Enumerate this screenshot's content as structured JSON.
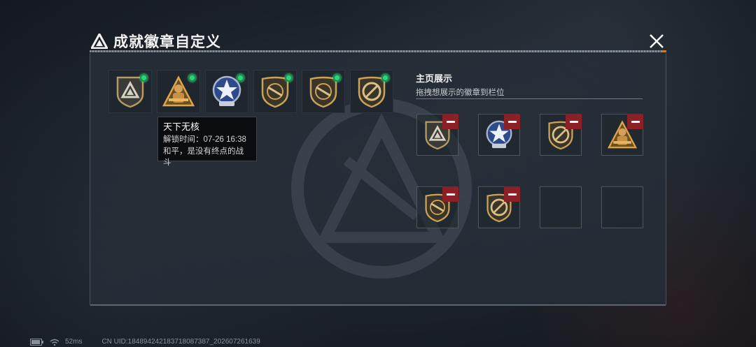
{
  "header": {
    "title": "成就徽章自定义",
    "title_icon": "triangle-emblem-icon",
    "close_icon": "close-icon"
  },
  "owned_badges": [
    {
      "name": "triangle-shield-badge",
      "unlocked": true
    },
    {
      "name": "soldier-triangle-badge",
      "unlocked": true
    },
    {
      "name": "star-round-badge",
      "unlocked": true
    },
    {
      "name": "rifle-shield-badge",
      "unlocked": true
    },
    {
      "name": "rifle-shield-badge",
      "unlocked": true
    },
    {
      "name": "no-gun-shield-badge",
      "unlocked": true
    }
  ],
  "tooltip": {
    "name": "天下无核",
    "unlock_label": "解锁时间：",
    "unlock_time": "07-26 16:38",
    "description": "和平，是没有终点的战斗"
  },
  "display": {
    "title": "主页展示",
    "subtitle": "拖拽想展示的徽章到栏位",
    "slots": [
      {
        "badge": "triangle-shield-badge",
        "removable": true
      },
      {
        "badge": "star-round-badge",
        "removable": true
      },
      {
        "badge": "no-gun-shield-badge",
        "removable": true
      },
      {
        "badge": "soldier-triangle-badge",
        "removable": true
      },
      {
        "badge": "rifle-shield-badge",
        "removable": true
      },
      {
        "badge": "no-gun-shield-badge",
        "removable": true
      },
      {
        "badge": "",
        "removable": false
      },
      {
        "badge": "",
        "removable": false
      }
    ]
  },
  "status_bar": {
    "ping": "52ms",
    "uid": "CN UID:1848942421837180873​87_202607261639"
  },
  "colors": {
    "accent_green": "#2ed47a",
    "remove_red": "#8b2126",
    "badge_gold": "#c9a15a"
  }
}
